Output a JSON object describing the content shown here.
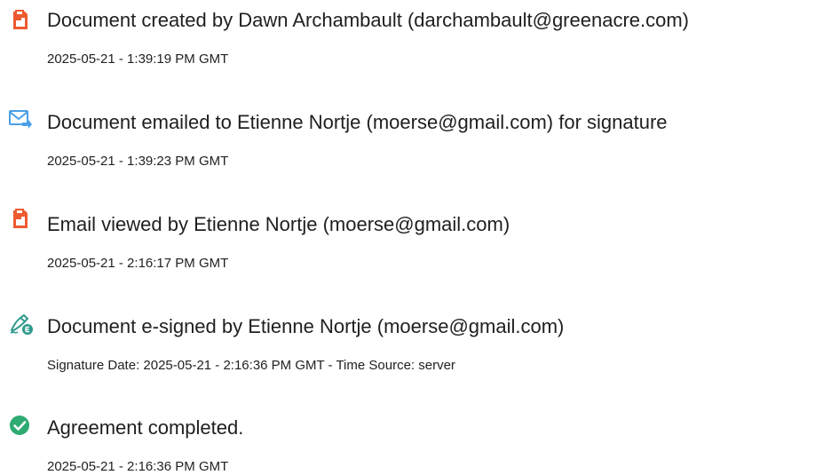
{
  "colors": {
    "doc_icon": "#ee5a2f",
    "email_icon": "#4a9fe8",
    "sign_icon": "#2f9a8c",
    "check_icon": "#2eaa73"
  },
  "events": [
    {
      "icon": "document-created-icon",
      "title": "Document created by Dawn Archambault (darchambault@greenacre.com)",
      "detail": "2025-05-21 - 1:39:19 PM GMT"
    },
    {
      "icon": "email-sent-icon",
      "title": "Document emailed to Etienne Nortje (moerse@gmail.com) for signature",
      "detail": "2025-05-21 - 1:39:23 PM GMT"
    },
    {
      "icon": "document-viewed-icon",
      "title": "Email viewed by Etienne Nortje (moerse@gmail.com)",
      "detail": "2025-05-21 - 2:16:17 PM GMT"
    },
    {
      "icon": "e-sign-pen-icon",
      "title": "Document e-signed by Etienne Nortje (moerse@gmail.com)",
      "detail": "Signature Date: 2025-05-21 - 2:16:36 PM GMT - Time Source: server"
    },
    {
      "icon": "checkmark-circle-icon",
      "title": "Agreement completed.",
      "detail": "2025-05-21 - 2:16:36 PM GMT"
    }
  ]
}
